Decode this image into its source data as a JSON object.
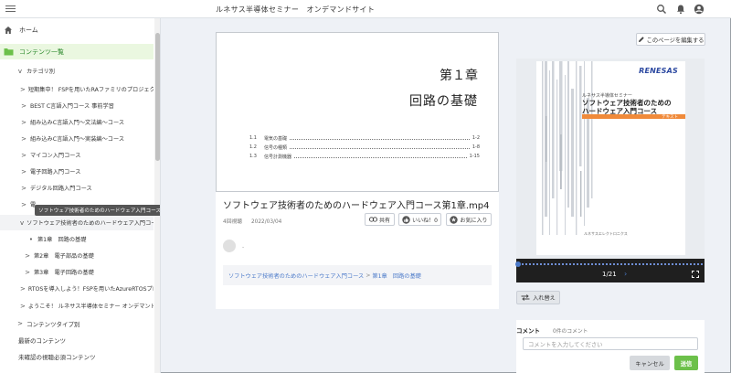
{
  "header": {
    "site_title": "ルネサス半導体セミナー　オンデマンドサイト"
  },
  "sidebar": {
    "items": [
      {
        "label": "ホーム",
        "icon": "home-icon"
      },
      {
        "label": "コンテンツ一覧",
        "icon": "folder-icon"
      },
      {
        "label": "カテゴリ別",
        "chevron": "v"
      },
      {
        "label": "短期集中！ FSPを用いたRAファミリのプロジェクト...",
        "chevron": ">"
      },
      {
        "label": "BEST C言語入門コース 事前学習",
        "chevron": ">"
      },
      {
        "label": "組み込みC言語入門～文法編～コース",
        "chevron": ">"
      },
      {
        "label": "組み込みC言語入門～実装編～コース",
        "chevron": ">"
      },
      {
        "label": "マイコン入門コース",
        "chevron": ">"
      },
      {
        "label": "電子回路入門コース",
        "chevron": ">"
      },
      {
        "label": "デジタル回路入門コース",
        "chevron": ">"
      },
      {
        "label": "電...",
        "chevron": ">"
      },
      {
        "label": "ソフトウェア技術者のためのハードウェア入門コース",
        "chevron": "v"
      },
      {
        "label": "第1章　回路の基礎",
        "chevron": "•"
      },
      {
        "label": "第2章　電子部品の基礎",
        "chevron": ">"
      },
      {
        "label": "第3章　電子回路の基礎",
        "chevron": ">"
      },
      {
        "label": "RTOSを導入しよう！FSPを用いたAzureRTOSプロジ...",
        "chevron": ">"
      },
      {
        "label": "ようこそ！ ルネサス半導体セミナー オンデマンドサ...",
        "chevron": ">"
      },
      {
        "label": "コンテンツタイプ別",
        "chevron": ">"
      },
      {
        "label": "最新のコンテンツ"
      },
      {
        "label": "未確認の視聴必須コンテンツ"
      }
    ],
    "tooltip": "ソフトウェア技術者のためのハードウェア入門コース"
  },
  "main": {
    "edit_button": "このページを編集する",
    "slide": {
      "chapter": "第１章",
      "title": "回路の基礎",
      "toc": [
        {
          "num": "1.1",
          "title": "電気の基礎",
          "page": "1-2"
        },
        {
          "num": "1.2",
          "title": "信号の種類",
          "page": "1-8"
        },
        {
          "num": "1.3",
          "title": "信号計測機器",
          "page": "1-15"
        }
      ]
    },
    "video_title": "ソフトウェア技術者のためのハードウェア入門コース第1章.mp4",
    "views": "4回視聴",
    "date": "2022/03/04",
    "share_label": "共有",
    "like_label": "いいね！0",
    "favorite_label": "お気に入り",
    "comment_dot": "-",
    "breadcrumb": {
      "course": "ソフトウェア技術者のためのハードウェア入門コース",
      "separator": ">",
      "chapter": "第1章　回路の基礎"
    }
  },
  "viewer": {
    "brand": "RENESAS",
    "cover_subtitle": "ルネサス半導体セミナー",
    "cover_title_1": "ソフトウェア技術者のための",
    "cover_title_2": "ハードウェア入門コース",
    "cover_band": "テキスト",
    "cover_footer": "ルネサスエレクトロニクス",
    "page_indicator": "1/21",
    "next_symbol": "›"
  },
  "swap_button": "入れ替え",
  "comments": {
    "header": "コメント",
    "count": "0件のコメント",
    "placeholder": "コメントを入力してください",
    "cancel": "キャンセル",
    "submit": "送信"
  },
  "colors": {
    "accent_green": "#6cc04a",
    "link_blue": "#4a79c9",
    "brand_blue": "#2b48a0",
    "orange_band": "#f08a3a"
  }
}
